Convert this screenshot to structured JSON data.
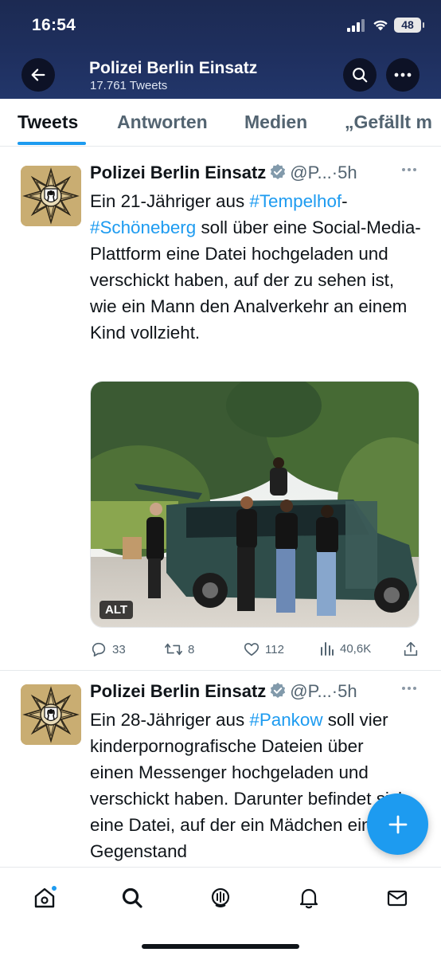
{
  "status_bar": {
    "time": "16:54",
    "battery": "48"
  },
  "header": {
    "title": "Polizei Berlin Einsatz",
    "subtitle": "17.761 Tweets"
  },
  "tabs": [
    {
      "label": "Tweets",
      "active": true
    },
    {
      "label": "Antworten",
      "active": false
    },
    {
      "label": "Medien",
      "active": false
    },
    {
      "label": "„Gefällt m",
      "active": false
    }
  ],
  "tweets": [
    {
      "name": "Polizei Berlin Einsatz",
      "handle": "@P...",
      "separator": "·",
      "time": "5h",
      "text": {
        "p1": "Ein 21-Jähriger aus ",
        "tag1": "#Tempelhof",
        "p2": "-",
        "tag2": "#Schöneberg",
        "p3": " soll über eine Social-Media-Plattform eine Datei hochgeladen und verschickt haben, auf der zu sehen ist, wie ein Mann den Analverkehr an einem Kind vollzieht."
      },
      "media_alt_badge": "ALT",
      "stats": {
        "replies": "33",
        "retweets": "8",
        "likes": "112",
        "views": "40,6K"
      }
    },
    {
      "name": "Polizei Berlin Einsatz",
      "handle": "@P...",
      "separator": "·",
      "time": "5h",
      "text": {
        "p1": "Ein 28-Jähriger aus ",
        "tag1": "#Pankow",
        "p2": " soll vier kinderpornografische Dateien über einen Messenger hochgeladen und verschickt haben. Darunter befindet sich eine Datei, auf der ein Mädchen einen Gegenstand"
      }
    }
  ],
  "colors": {
    "accent": "#1d9bf0",
    "header_bg": "#1f3060",
    "text": "#0f1419",
    "muted": "#536471"
  },
  "icons": [
    "back-arrow-icon",
    "search-icon",
    "more-icon",
    "verified-icon",
    "reply-icon",
    "retweet-icon",
    "like-icon",
    "views-icon",
    "share-icon",
    "compose-icon",
    "home-icon",
    "spaces-icon",
    "notifications-icon",
    "messages-icon"
  ]
}
